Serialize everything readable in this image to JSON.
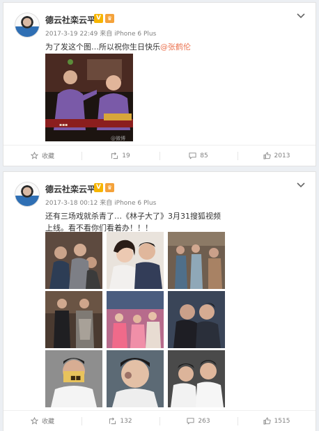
{
  "posts": [
    {
      "author": "德云社栾云平",
      "verified_badge": "V",
      "date": "2017-3-19 22:49",
      "source_prefix": "来自",
      "source": "iPhone 6 Plus",
      "text_main": "为了发这个图…所以祝你生日快乐",
      "mention": "@张鹤伦",
      "watermark": "@微博",
      "actions": {
        "favorite": "收藏",
        "repost": "19",
        "comment": "85",
        "like": "2013"
      }
    },
    {
      "author": "德云社栾云平",
      "verified_badge": "V",
      "date": "2017-3-18 00:12",
      "source_prefix": "来自",
      "source": "iPhone 6 Plus",
      "text_main": "还有三场戏就杀青了…《林子大了》3月31搜狐视频上线。看不看你们看着办！！！",
      "actions": {
        "favorite": "收藏",
        "repost": "132",
        "comment": "263",
        "like": "1515"
      }
    }
  ],
  "colors": {
    "mention": "#eb7350",
    "badge": "#f7b500"
  },
  "icons": [
    "avatar",
    "verified-badge",
    "member-crown-icon",
    "chevron-down-icon",
    "favorite-icon",
    "repost-icon",
    "comment-icon",
    "like-icon"
  ]
}
